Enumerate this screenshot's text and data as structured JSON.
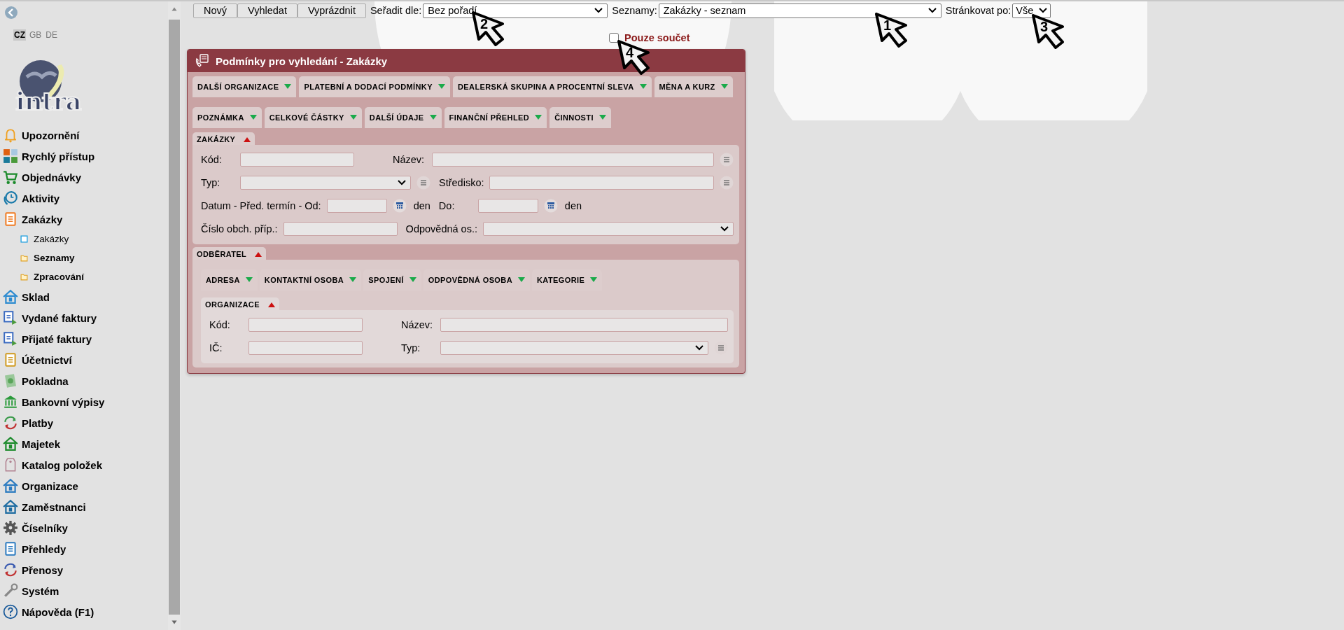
{
  "sidebar": {
    "languages": [
      {
        "label": "CZ",
        "selected": true
      },
      {
        "label": "GB",
        "selected": false
      },
      {
        "label": "DE",
        "selected": false
      }
    ],
    "logo_text": "intra",
    "nav": [
      {
        "label": "Upozornění"
      },
      {
        "label": "Rychlý přístup"
      },
      {
        "label": "Objednávky"
      },
      {
        "label": "Aktivity"
      },
      {
        "label": "Zakázky",
        "children": [
          {
            "label": "Zakázky",
            "kind": "page"
          },
          {
            "label": "Seznamy",
            "kind": "folder"
          },
          {
            "label": "Zpracování",
            "kind": "folder"
          }
        ]
      },
      {
        "label": "Sklad"
      },
      {
        "label": "Vydané faktury"
      },
      {
        "label": "Přijaté faktury"
      },
      {
        "label": "Účetnictví"
      },
      {
        "label": "Pokladna"
      },
      {
        "label": "Bankovní výpisy"
      },
      {
        "label": "Platby"
      },
      {
        "label": "Majetek"
      },
      {
        "label": "Katalog položek"
      },
      {
        "label": "Organizace"
      },
      {
        "label": "Zaměstnanci"
      },
      {
        "label": "Číselníky"
      },
      {
        "label": "Přehledy"
      },
      {
        "label": "Přenosy"
      },
      {
        "label": "Systém"
      },
      {
        "label": "Nápověda (F1)"
      }
    ]
  },
  "toolbar": {
    "buttons": [
      "Nový",
      "Vyhledat",
      "Vyprázdnit"
    ],
    "sort": {
      "label": "Seřadit dle:",
      "value": "Bez pořadí"
    },
    "lists": {
      "label": "Seznamy:",
      "value": "Zakázky - seznam"
    },
    "paging": {
      "label": "Stránkovat po:",
      "value": "Vše"
    },
    "total_only": {
      "label": "Pouze součet",
      "checked": false
    }
  },
  "panel": {
    "title": "Podmínky pro vyhledání - Zakázky",
    "tab_rows": [
      [
        {
          "label": "DALŠÍ ORGANIZACE",
          "expanded": false
        },
        {
          "label": "PLATEBNÍ A DODACÍ PODMÍNKY",
          "expanded": false
        },
        {
          "label": "DEALERSKÁ SKUPINA A PROCENTNÍ SLEVA",
          "expanded": false
        },
        {
          "label": "MĚNA A KURZ",
          "expanded": false
        }
      ],
      [
        {
          "label": "POZNÁMKA",
          "expanded": false
        },
        {
          "label": "CELKOVÉ ČÁSTKY",
          "expanded": false
        },
        {
          "label": "DALŠÍ ÚDAJE",
          "expanded": false
        },
        {
          "label": "FINANČNÍ PŘEHLED",
          "expanded": false
        },
        {
          "label": "ČINNOSTI",
          "expanded": false
        }
      ]
    ],
    "sections": [
      {
        "title": "ZAKÁZKY",
        "expanded": true,
        "rows": [
          [
            {
              "label": "Kód:",
              "kind": "text",
              "list_button": false
            },
            {
              "label": "Název:",
              "kind": "text",
              "list_button": true
            }
          ],
          [
            {
              "label": "Typ:",
              "kind": "select",
              "list_button": true
            },
            {
              "label": "Středisko:",
              "kind": "text",
              "list_button": true
            }
          ],
          [
            {
              "label": "Datum - Před. termín - Od:",
              "kind": "date",
              "list_button": false,
              "suffix": "den"
            },
            {
              "label": "Do:",
              "kind": "date",
              "list_button": false,
              "suffix": "den"
            }
          ],
          [
            {
              "label": "Číslo obch. příp.:",
              "kind": "text",
              "list_button": false
            },
            {
              "label": "Odpovědná os.:",
              "kind": "select",
              "list_button": false
            }
          ]
        ]
      },
      {
        "title": "ODBĚRATEL",
        "expanded": true,
        "tabs": [
          {
            "label": "ADRESA",
            "expanded": false
          },
          {
            "label": "KONTAKTNÍ OSOBA",
            "expanded": false
          },
          {
            "label": "SPOJENÍ",
            "expanded": false
          },
          {
            "label": "ODPOVĚDNÁ OSOBA",
            "expanded": false
          },
          {
            "label": "KATEGORIE",
            "expanded": false
          }
        ],
        "subsections": [
          {
            "title": "ORGANIZACE",
            "expanded": true,
            "rows": [
              [
                {
                  "label": "Kód:",
                  "kind": "text",
                  "list_button": false
                },
                {
                  "label": "Název:",
                  "kind": "text",
                  "list_button": false
                }
              ],
              [
                {
                  "label": "IČ:",
                  "kind": "text",
                  "list_button": false
                },
                {
                  "label": "Typ:",
                  "kind": "select",
                  "list_button": true
                }
              ]
            ]
          }
        ]
      }
    ]
  },
  "callouts": [
    {
      "number": "2"
    },
    {
      "number": "4"
    },
    {
      "number": "1"
    },
    {
      "number": "3"
    }
  ]
}
